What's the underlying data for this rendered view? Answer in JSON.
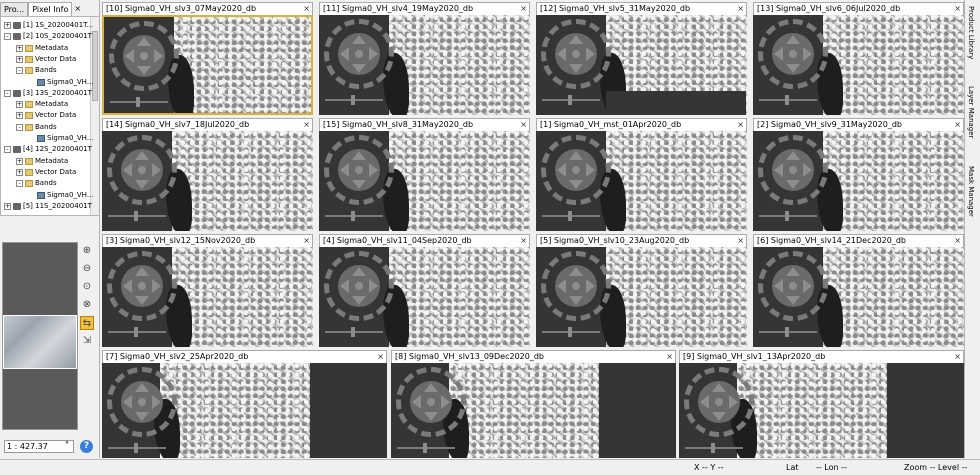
{
  "left_panel": {
    "tabs": [
      "Pro...",
      "Pixel Info",
      "×"
    ],
    "tree": [
      {
        "label": "[1] 1S_20200401T...",
        "type": "prod",
        "level": 0,
        "toggle": "+"
      },
      {
        "label": "[2] 10S_20200401T",
        "type": "prod",
        "level": 0,
        "toggle": "-"
      },
      {
        "label": "Metadata",
        "type": "fold",
        "level": 1,
        "toggle": "+"
      },
      {
        "label": "Vector Data",
        "type": "fold",
        "level": 1,
        "toggle": "+"
      },
      {
        "label": "Bands",
        "type": "fold",
        "level": 1,
        "toggle": "-"
      },
      {
        "label": "Sigma0_VH...",
        "type": "band",
        "level": 2,
        "toggle": ""
      },
      {
        "label": "[3] 13S_20200401T",
        "type": "prod",
        "level": 0,
        "toggle": "-"
      },
      {
        "label": "Metadata",
        "type": "fold",
        "level": 1,
        "toggle": "+"
      },
      {
        "label": "Vector Data",
        "type": "fold",
        "level": 1,
        "toggle": "+"
      },
      {
        "label": "Bands",
        "type": "fold",
        "level": 1,
        "toggle": "-"
      },
      {
        "label": "Sigma0_VH...",
        "type": "band",
        "level": 2,
        "toggle": ""
      },
      {
        "label": "[4] 12S_20200401T",
        "type": "prod",
        "level": 0,
        "toggle": "-"
      },
      {
        "label": "Metadata",
        "type": "fold",
        "level": 1,
        "toggle": "+"
      },
      {
        "label": "Vector Data",
        "type": "fold",
        "level": 1,
        "toggle": "+"
      },
      {
        "label": "Bands",
        "type": "fold",
        "level": 1,
        "toggle": "-"
      },
      {
        "label": "Sigma0_VH...",
        "type": "band",
        "level": 2,
        "toggle": ""
      },
      {
        "label": "[5] 11S_20200401T",
        "type": "prod",
        "level": 0,
        "toggle": "+"
      }
    ],
    "nav_tools": [
      "zoom-in",
      "zoom-out",
      "zoom-pixel",
      "zoom-all",
      "sync-views",
      "sync-cursor"
    ],
    "scale_value": "1 : 427.37",
    "scale_unit": "°",
    "help": "?"
  },
  "right_tabs": [
    "Product Library",
    "Layer Manager",
    "Mask Manager"
  ],
  "views": [
    {
      "title": "[10] Sigma0_VH_slv3_07May2020_db",
      "active": true
    },
    {
      "title": "[11] Sigma0_VH_slv4_19May2020_db"
    },
    {
      "title": "[12] Sigma0_VH_slv5_31May2020_db"
    },
    {
      "title": "[13] Sigma0_VH_slv6_06Jul2020_db"
    },
    {
      "title": "[14] Sigma0_VH_slv7_18Jul2020_db"
    },
    {
      "title": "[15] Sigma0_VH_slv8_31May2020_db"
    },
    {
      "title": "[1] Sigma0_VH_mst_01Apr2020_db"
    },
    {
      "title": "[2] Sigma0_VH_slv9_31May2020_db"
    },
    {
      "title": "[3] Sigma0_VH_slv12_15Nov2020_db"
    },
    {
      "title": "[4] Sigma0_VH_slv11_04Sep2020_db"
    },
    {
      "title": "[5] Sigma0_VH_slv10_23Aug2020_db"
    },
    {
      "title": "[6] Sigma0_VH_slv14_21Dec2020_db"
    },
    {
      "title": "[7] Sigma0_VH_slv2_25Apr2020_db"
    },
    {
      "title": "[8] Sigma0_VH_slv13_09Dec2020_db"
    },
    {
      "title": "[9] Sigma0_VH_slv1_13Apr2020_db"
    }
  ],
  "close_glyph": "×",
  "status": {
    "x": "X -- Y --",
    "lat": "Lat",
    "lon": "-- Lon --",
    "zoom": "Zoom --  Level --"
  }
}
